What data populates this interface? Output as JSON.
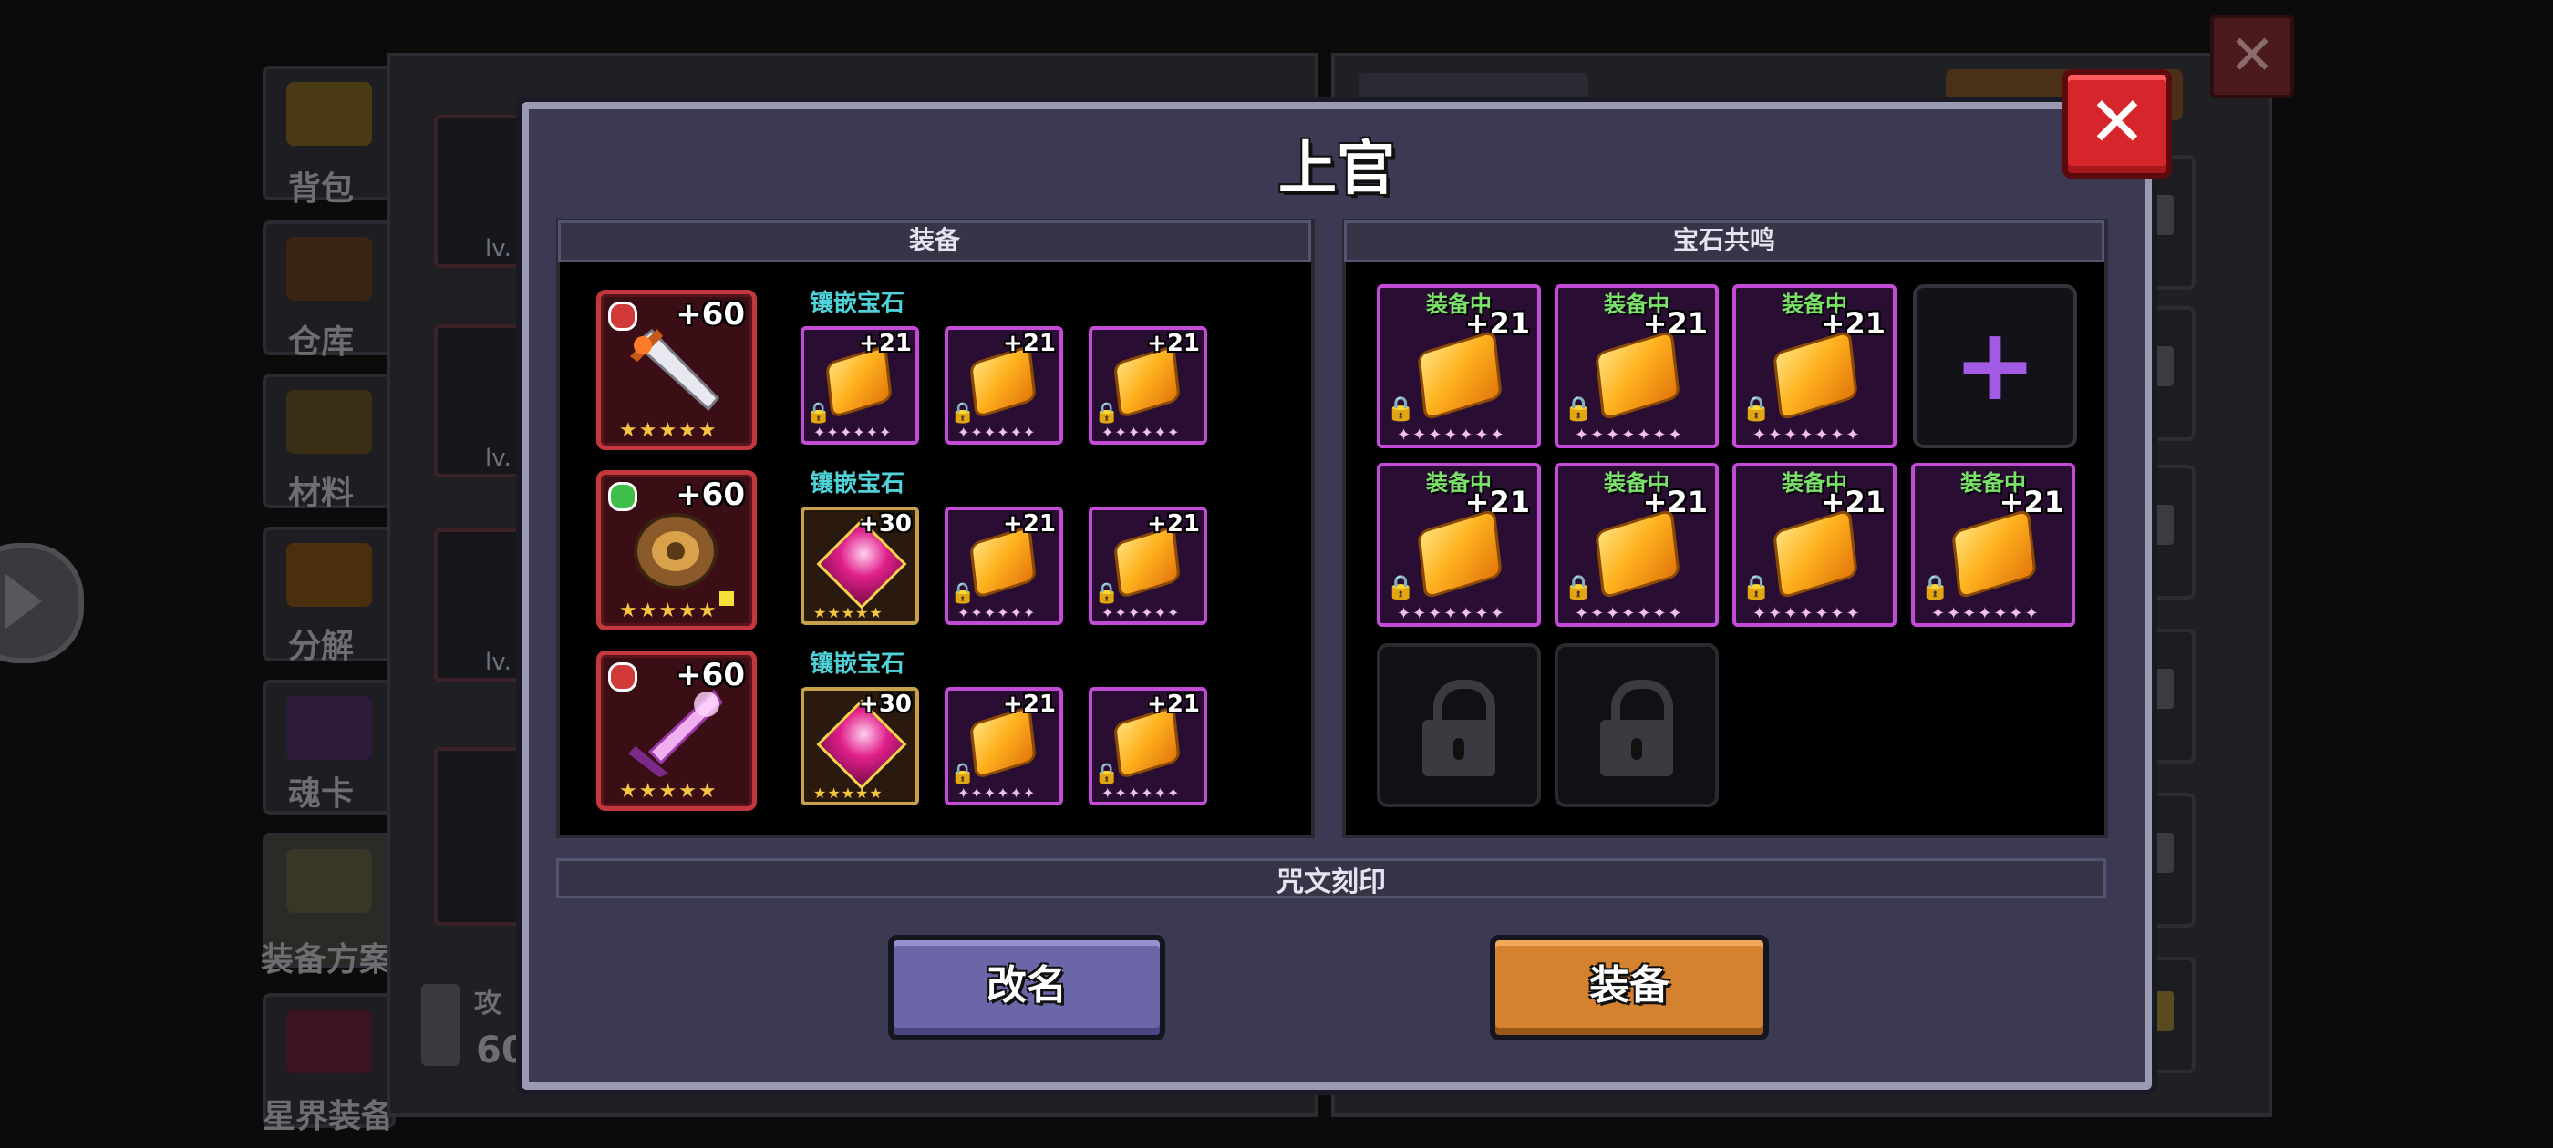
{
  "background": {
    "sidebar": [
      {
        "label": "背包"
      },
      {
        "label": "仓库"
      },
      {
        "label": "材料"
      },
      {
        "label": "分解"
      },
      {
        "label": "魂卡"
      },
      {
        "label": "装备方案"
      },
      {
        "label": "星界装备"
      }
    ],
    "hero_levels": [
      "lv.",
      "lv.",
      "lv."
    ],
    "attack_label": "攻",
    "attack_value": "60"
  },
  "modal": {
    "title": "上官",
    "equipment_section": "装备",
    "resonance_section": "宝石共鸣",
    "rune_section": "咒文刻印",
    "inlay_label": "镶嵌宝石",
    "equipment": [
      {
        "name": "sword",
        "plus": "+60",
        "stars": "★★★★★",
        "gem_color": "#d23a3a",
        "gems": [
          {
            "kind": "scroll",
            "level": "+21"
          },
          {
            "kind": "scroll",
            "level": "+21"
          },
          {
            "kind": "scroll",
            "level": "+21"
          }
        ]
      },
      {
        "name": "shield",
        "plus": "+60",
        "stars": "★★★★★",
        "gem_color": "#3fbf4a",
        "gems": [
          {
            "kind": "ruby",
            "level": "+30"
          },
          {
            "kind": "scroll",
            "level": "+21"
          },
          {
            "kind": "scroll",
            "level": "+21"
          }
        ]
      },
      {
        "name": "blade",
        "plus": "+60",
        "stars": "★★★★★",
        "gem_color": "#d23a3a",
        "gems": [
          {
            "kind": "ruby",
            "level": "+30"
          },
          {
            "kind": "scroll",
            "level": "+21"
          },
          {
            "kind": "scroll",
            "level": "+21"
          }
        ]
      }
    ],
    "resonance": {
      "equipped_label": "装备中",
      "slots": [
        {
          "level": "+21"
        },
        {
          "level": "+21"
        },
        {
          "level": "+21"
        },
        {
          "level": "+21"
        },
        {
          "level": "+21"
        },
        {
          "level": "+21"
        },
        {
          "level": "+21"
        }
      ],
      "add_symbol": "+"
    },
    "buttons": {
      "rename": "改名",
      "equip": "装备"
    },
    "close_symbol": "✕"
  },
  "colors": {
    "rename": "#6b66a8",
    "equip": "#d4822f",
    "close": "#d7262b",
    "inlay_text": "#4fd3d9",
    "equipped_text": "#7be36a"
  }
}
